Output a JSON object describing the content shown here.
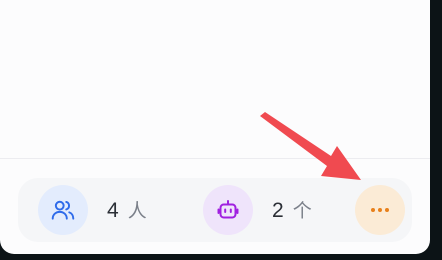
{
  "colors": {
    "panel_bg": "#fcfcfd",
    "bar_bg": "#f5f6f8",
    "users_accent": "#2f6bea",
    "users_bg": "#e3ecfd",
    "bot_accent": "#a020e0",
    "bot_bg": "#efe4fb",
    "more_accent": "#e8801c",
    "more_bg": "#fbebd6",
    "arrow": "#f04a50"
  },
  "stats": {
    "members": {
      "icon": "users-icon",
      "count": "4",
      "unit": "人"
    },
    "bots": {
      "icon": "robot-icon",
      "count": "2",
      "unit": "个"
    }
  },
  "more": {
    "icon": "more-horizontal-icon"
  },
  "annotation": {
    "icon": "red-arrow-pointer"
  }
}
